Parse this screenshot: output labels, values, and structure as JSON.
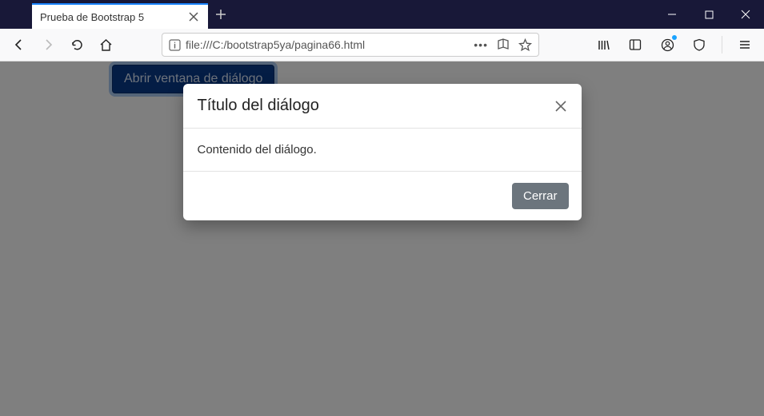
{
  "browser": {
    "tab_title": "Prueba de Bootstrap 5",
    "url": "file:///C:/bootstrap5ya/pagina66.html"
  },
  "page": {
    "open_button_label": "Abrir ventana de diálogo"
  },
  "modal": {
    "title": "Título del diálogo",
    "body": "Contenido del diálogo.",
    "close_button_label": "Cerrar"
  }
}
